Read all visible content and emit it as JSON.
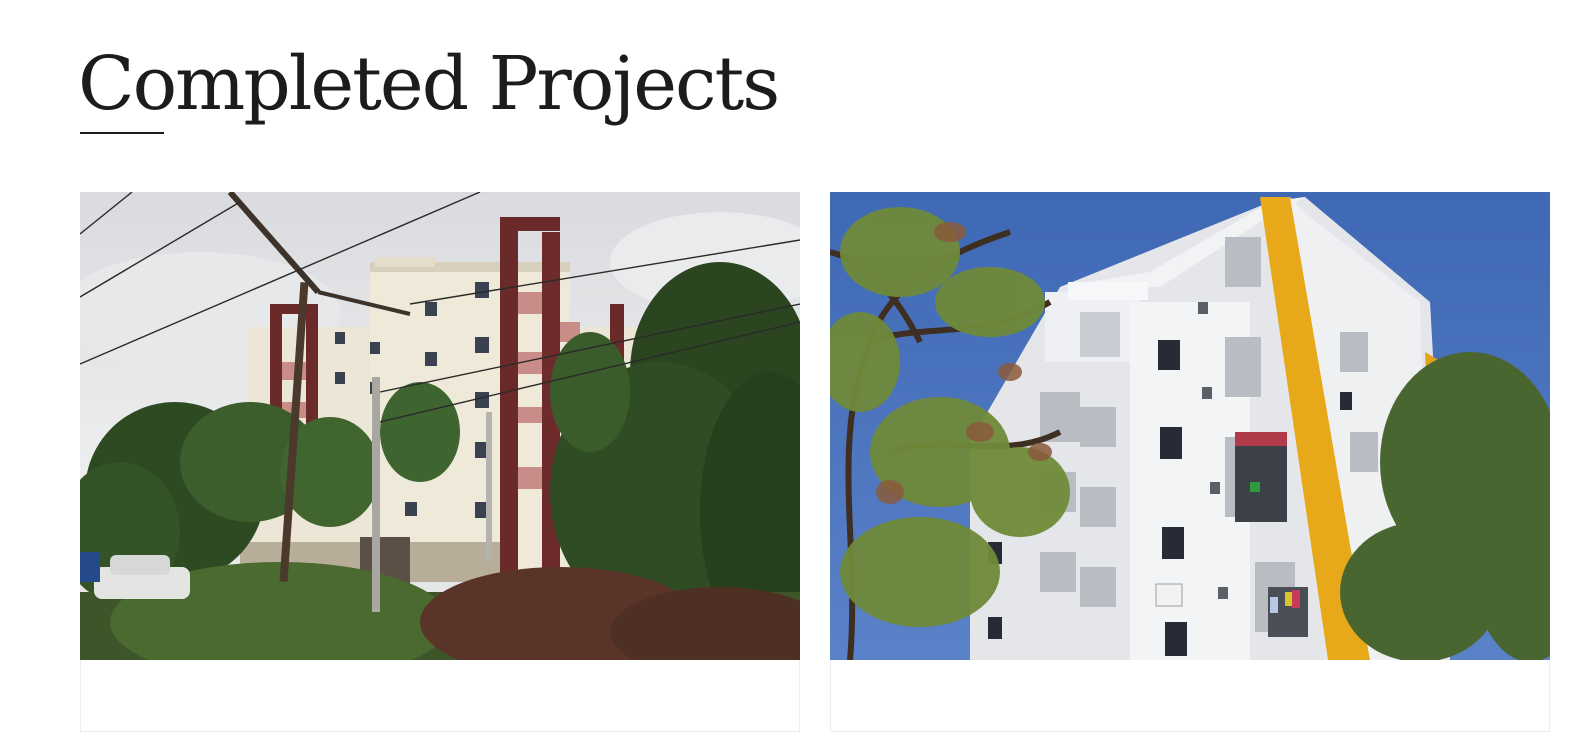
{
  "section": {
    "title": "Completed Projects"
  },
  "projects": [
    {
      "photo_description": "six-storey cream building with maroon balconies behind trees and power lines"
    },
    {
      "photo_description": "white apartment tower with yellow tiled stripe against blue sky and tree branches"
    }
  ],
  "colors": {
    "heading": "#1c1c1c",
    "card_border": "#ececec",
    "background": "#ffffff"
  }
}
